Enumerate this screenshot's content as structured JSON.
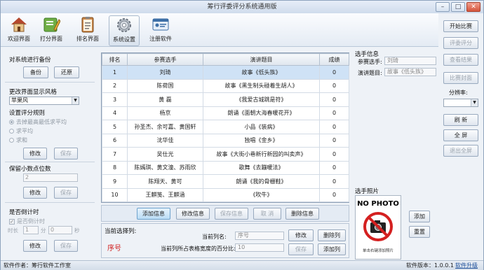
{
  "window": {
    "title": "筹行评委评分系统通用版"
  },
  "toolbar": {
    "items": [
      {
        "label": "欢迎界面"
      },
      {
        "label": "打分界面"
      },
      {
        "label": "排名界面"
      },
      {
        "label": "系统设置"
      },
      {
        "label": "注册软件"
      }
    ]
  },
  "left": {
    "backup_title": "对系统进行备份",
    "backup_btn": "备份",
    "restore_btn": "还原",
    "skin_title": "更改界面显示风格",
    "skin_value": "苹果风",
    "rule_title": "设置评分规则",
    "rule_opt1": "去掉最高最低求平均",
    "rule_opt2": "求平均",
    "rule_opt3": "求和",
    "rule_modify": "修改",
    "rule_save": "保存",
    "decimal_title": "保留小数点位数",
    "decimal_value": "2",
    "decimal_modify": "修改",
    "decimal_save": "保存",
    "timer_title": "是否倒计时",
    "timer_check": "是否倒计时",
    "timer_label": "时长",
    "timer_min": "1",
    "timer_min_unit": "分",
    "timer_sec": "0",
    "timer_sec_unit": "秒",
    "timer_modify": "修改",
    "timer_save": "保存"
  },
  "grid": {
    "headers": [
      "排名",
      "参赛选手",
      "演讲题目",
      "成绩"
    ],
    "rows": [
      [
        "1",
        "刘琦",
        "故事《低头族》",
        "0"
      ],
      [
        "2",
        "陈荷国",
        "故事《黑生制头碰着生胡人》",
        "0"
      ],
      [
        "3",
        "黄 磊",
        "《我爱古城跳是符》",
        "0"
      ],
      [
        "4",
        "杨京",
        "朗诵《面朝大海春暖花开》",
        "0"
      ],
      [
        "5",
        "孙圣杰、余可嘉、黄国轩",
        "小品《装病》",
        "0"
      ],
      [
        "6",
        "沈华佳",
        "独唱《金乡》",
        "0"
      ],
      [
        "7",
        "吴仕光",
        "故事《大街小巷新行新园的叫卖声》",
        "0"
      ],
      [
        "8",
        "陈嫣琪、黄文潼、苏雨欣",
        "歌舞《去蹦暖法》",
        "0"
      ],
      [
        "9",
        "陈翔天、黄可",
        "朗诵《我的骨栅鞋》",
        "0"
      ],
      [
        "10",
        "王麒笺、王麒涵",
        "《吹牛》",
        "0"
      ]
    ]
  },
  "actions": {
    "add": "添加信息",
    "modify": "修改信息",
    "save": "保存信息",
    "cancel": "取 消",
    "delete": "删除信息"
  },
  "bottom": {
    "cur_col_title": "当前选择列:",
    "cur_col_value": "序号",
    "colname_label": "当前列名:",
    "colname_value": "序号",
    "width_label": "当前列所占表格宽度的百分比:",
    "width_value": "10",
    "modify": "修改",
    "delete_col": "删除列",
    "save": "保存",
    "add_col": "添加列"
  },
  "info": {
    "title": "选手信息",
    "player_label": "参赛选手:",
    "player_value": "刘琦",
    "topic_label": "演讲题目:",
    "topic_value": "故事《低头族》",
    "photo_title": "选手照片",
    "photo_text": "NO PHOTO",
    "photo_hint": "单击右键添加照片",
    "add_btn": "添加",
    "reset_btn": "重置"
  },
  "right": {
    "start": "开始比赛",
    "score": "评委评分",
    "result": "查看结果",
    "cover": "比赛封面",
    "resolution_label": "分辨率:",
    "refresh": "刷 新",
    "fullscreen": "全 屏",
    "exit_full": "退出全屏"
  },
  "status": {
    "author_label": "软件作者：",
    "author_value": "筹行软件工作室",
    "version_label": "软件版本：",
    "version_value": "1.0.0.1",
    "upgrade": "软件升级"
  }
}
